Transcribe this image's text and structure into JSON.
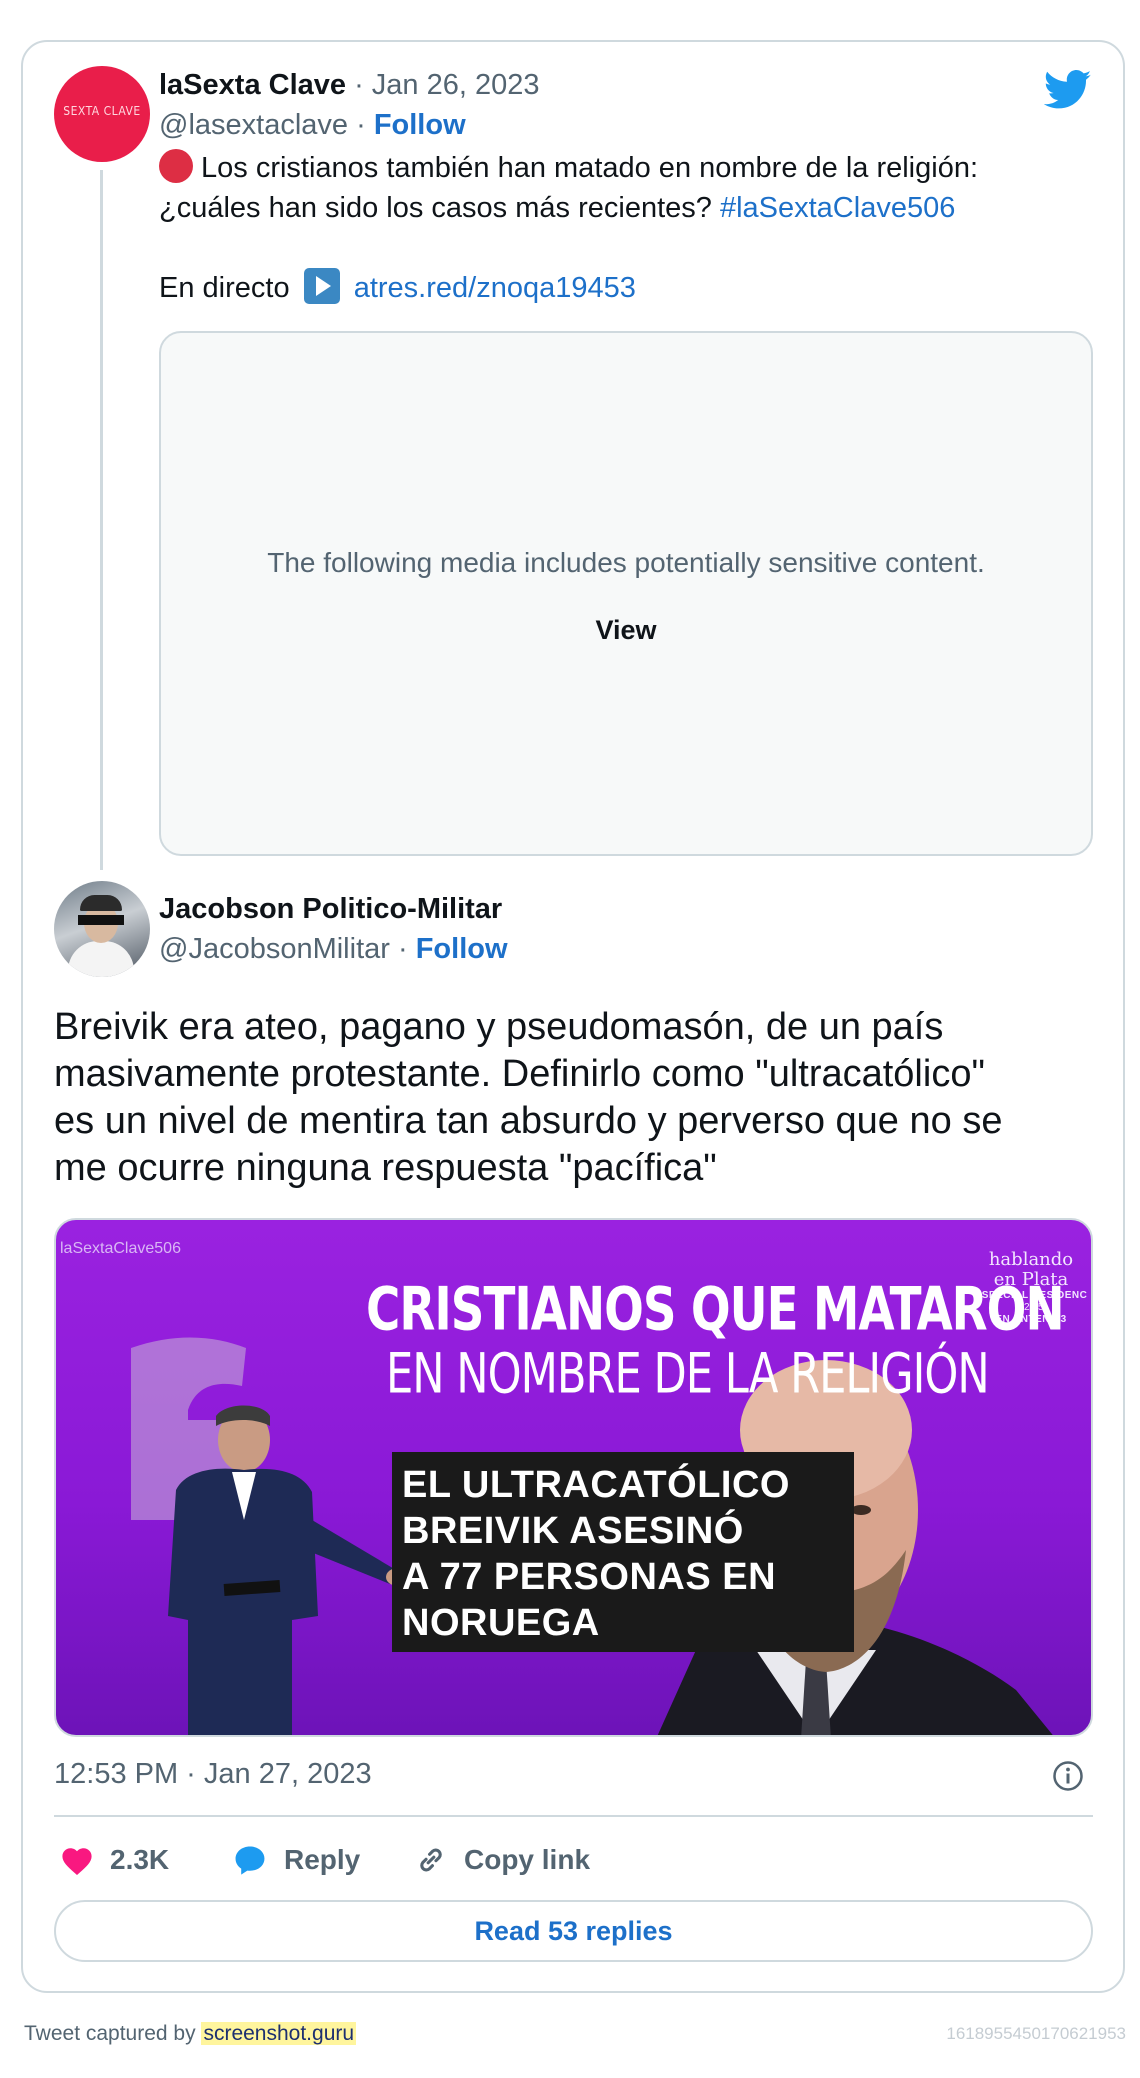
{
  "quoted_tweet": {
    "author_name": "laSexta Clave",
    "date": "Jan 26, 2023",
    "handle": "@lasextaclave",
    "follow_label": "Follow",
    "avatar_logo_text": "SEXTA CLAVE",
    "text_line1": "Los cristianos también han matado en nombre de la religión:",
    "text_line2": "¿cuáles han sido los casos más recientes?",
    "hashtag": "#laSextaClave506",
    "live_label": "En directo",
    "link": "atres.red/znoqa19453",
    "sensitive_message": "The following media includes potentially sensitive content.",
    "view_label": "View"
  },
  "main_tweet": {
    "author_name": "Jacobson Politico-Militar",
    "handle": "@JacobsonMilitar",
    "follow_label": "Follow",
    "text_lines": [
      "Breivik era ateo, pagano y pseudomasón, de un país",
      "masivamente protestante. Definirlo como \"ultracatólico\"",
      "es un nivel de mentira tan absurdo y perverso que no se",
      "me ocurre ninguna respuesta \"pacífica\""
    ],
    "media": {
      "hashtag": "laSextaClave506",
      "headline1": "CRISTIANOS QUE MATARON",
      "headline2": "EN NOMBRE DE LA RELIGIÓN",
      "caption_lines": [
        "EL ULTRACATÓLICO",
        "BREIVIK ASESINÓ",
        "A 77 PERSONAS EN",
        "NORUEGA"
      ],
      "promo_line1": "hablando",
      "promo_line2": "en Plata",
      "promo_line3": "ESPECIAL RESIDENC",
      "promo_line4": "22:45",
      "promo_line5": "EN ANTENA 3"
    },
    "timestamp": "12:53 PM · Jan 27, 2023"
  },
  "actions": {
    "likes": "2.3K",
    "reply_label": "Reply",
    "copy_label": "Copy link",
    "read_replies_label": "Read 53 replies"
  },
  "footer": {
    "captured_by": "Tweet captured by",
    "site": "screenshot.guru",
    "tweet_id": "1618955450170621953"
  },
  "colors": {
    "link_blue": "#1d70c9",
    "twitter_blue": "#1d9bf0",
    "like_pink": "#f91880",
    "border": "#cfd9de",
    "muted_text": "#536471",
    "media_purple": "#9a22e0"
  },
  "icons": [
    "twitter-bird-icon",
    "red-circle-icon",
    "play-button-icon",
    "info-icon",
    "heart-icon",
    "reply-bubble-icon",
    "link-icon"
  ]
}
